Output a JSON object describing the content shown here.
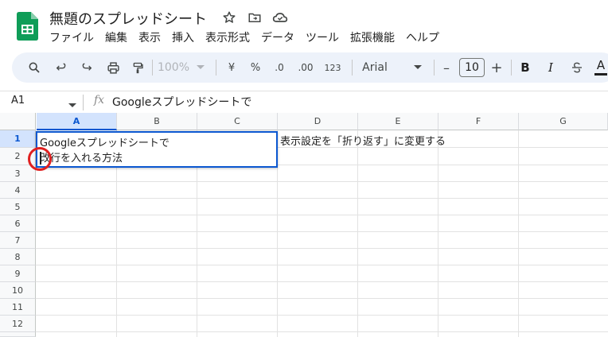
{
  "app": {
    "title": "無題のスプレッドシート",
    "title_icons": [
      "star-icon",
      "move-to-folder-icon",
      "cloud-status-icon"
    ],
    "accent_color": "#0b57d0",
    "logo_color": "#0f9d58"
  },
  "menu": [
    "ファイル",
    "編集",
    "表示",
    "挿入",
    "表示形式",
    "データ",
    "ツール",
    "拡張機能",
    "ヘルプ"
  ],
  "toolbar": {
    "icons": [
      "search-icon",
      "undo-icon",
      "redo-icon",
      "print-icon",
      "paint-format-icon"
    ],
    "zoom": "100%",
    "currency": "¥",
    "percent": "%",
    "decrease_decimal": ".0",
    "increase_decimal": ".00",
    "number_format": "123",
    "font_family": "Arial",
    "font_size": "10",
    "minus": "–",
    "plus": "+",
    "bold": "B",
    "italic": "I",
    "text_color": "A"
  },
  "formula_bar": {
    "cell_ref": "A1",
    "fx": "fx",
    "content": "Googleスプレッドシートで"
  },
  "grid": {
    "columns": [
      "A",
      "B",
      "C",
      "D",
      "E",
      "F",
      "G"
    ],
    "selected_column": "A",
    "rows": [
      "1",
      "2",
      "3",
      "4",
      "5",
      "6",
      "7",
      "8",
      "9",
      "10",
      "11",
      "12"
    ],
    "selected_row": "1",
    "editing_cell": {
      "ref": "A1",
      "line1": "Googleスプレッドシートで",
      "line2": "改行を入れる方法"
    },
    "d1": "表示設定を「折り返す」に変更する"
  }
}
